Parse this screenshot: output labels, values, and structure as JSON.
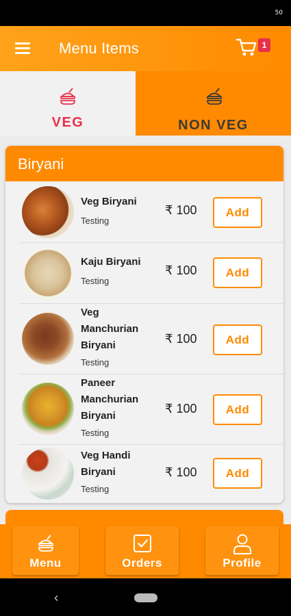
{
  "status_bar": {
    "clock": "50"
  },
  "app_bar": {
    "title": "Menu Items",
    "menu_icon": "hamburger-menu-icon",
    "cart_icon": "cart-icon",
    "cart_count": "1"
  },
  "tabs": [
    {
      "label": "VEG",
      "icon": "food-icon",
      "selected": true,
      "color": "#e8304a"
    },
    {
      "label": "NON VEG",
      "icon": "food-icon",
      "selected": false
    }
  ],
  "category": {
    "title": "Biryani",
    "items": [
      {
        "name": "Veg Biryani",
        "description": "Testing",
        "price": "₹ 100",
        "add_label": "Add"
      },
      {
        "name": "Kaju Biryani",
        "description": "Testing",
        "price": "₹ 100",
        "add_label": "Add"
      },
      {
        "name": "Veg Manchurian Biryani",
        "description": "Testing",
        "price": "₹ 100",
        "add_label": "Add"
      },
      {
        "name": "Paneer Manchurian Biryani",
        "description": "Testing",
        "price": "₹ 100",
        "add_label": "Add"
      },
      {
        "name": "Veg Handi Biryani",
        "description": "Testing",
        "price": "₹ 100",
        "add_label": "Add"
      }
    ]
  },
  "bottom_nav": [
    {
      "label": "Menu",
      "icon": "food-icon"
    },
    {
      "label": "Orders",
      "icon": "checkbox-icon"
    },
    {
      "label": "Profile",
      "icon": "person-icon"
    }
  ],
  "colors": {
    "accent": "#ff8a00",
    "accent_light": "#ffa31a",
    "veg_tab_text": "#e8304a",
    "badge": "#e8304a"
  }
}
